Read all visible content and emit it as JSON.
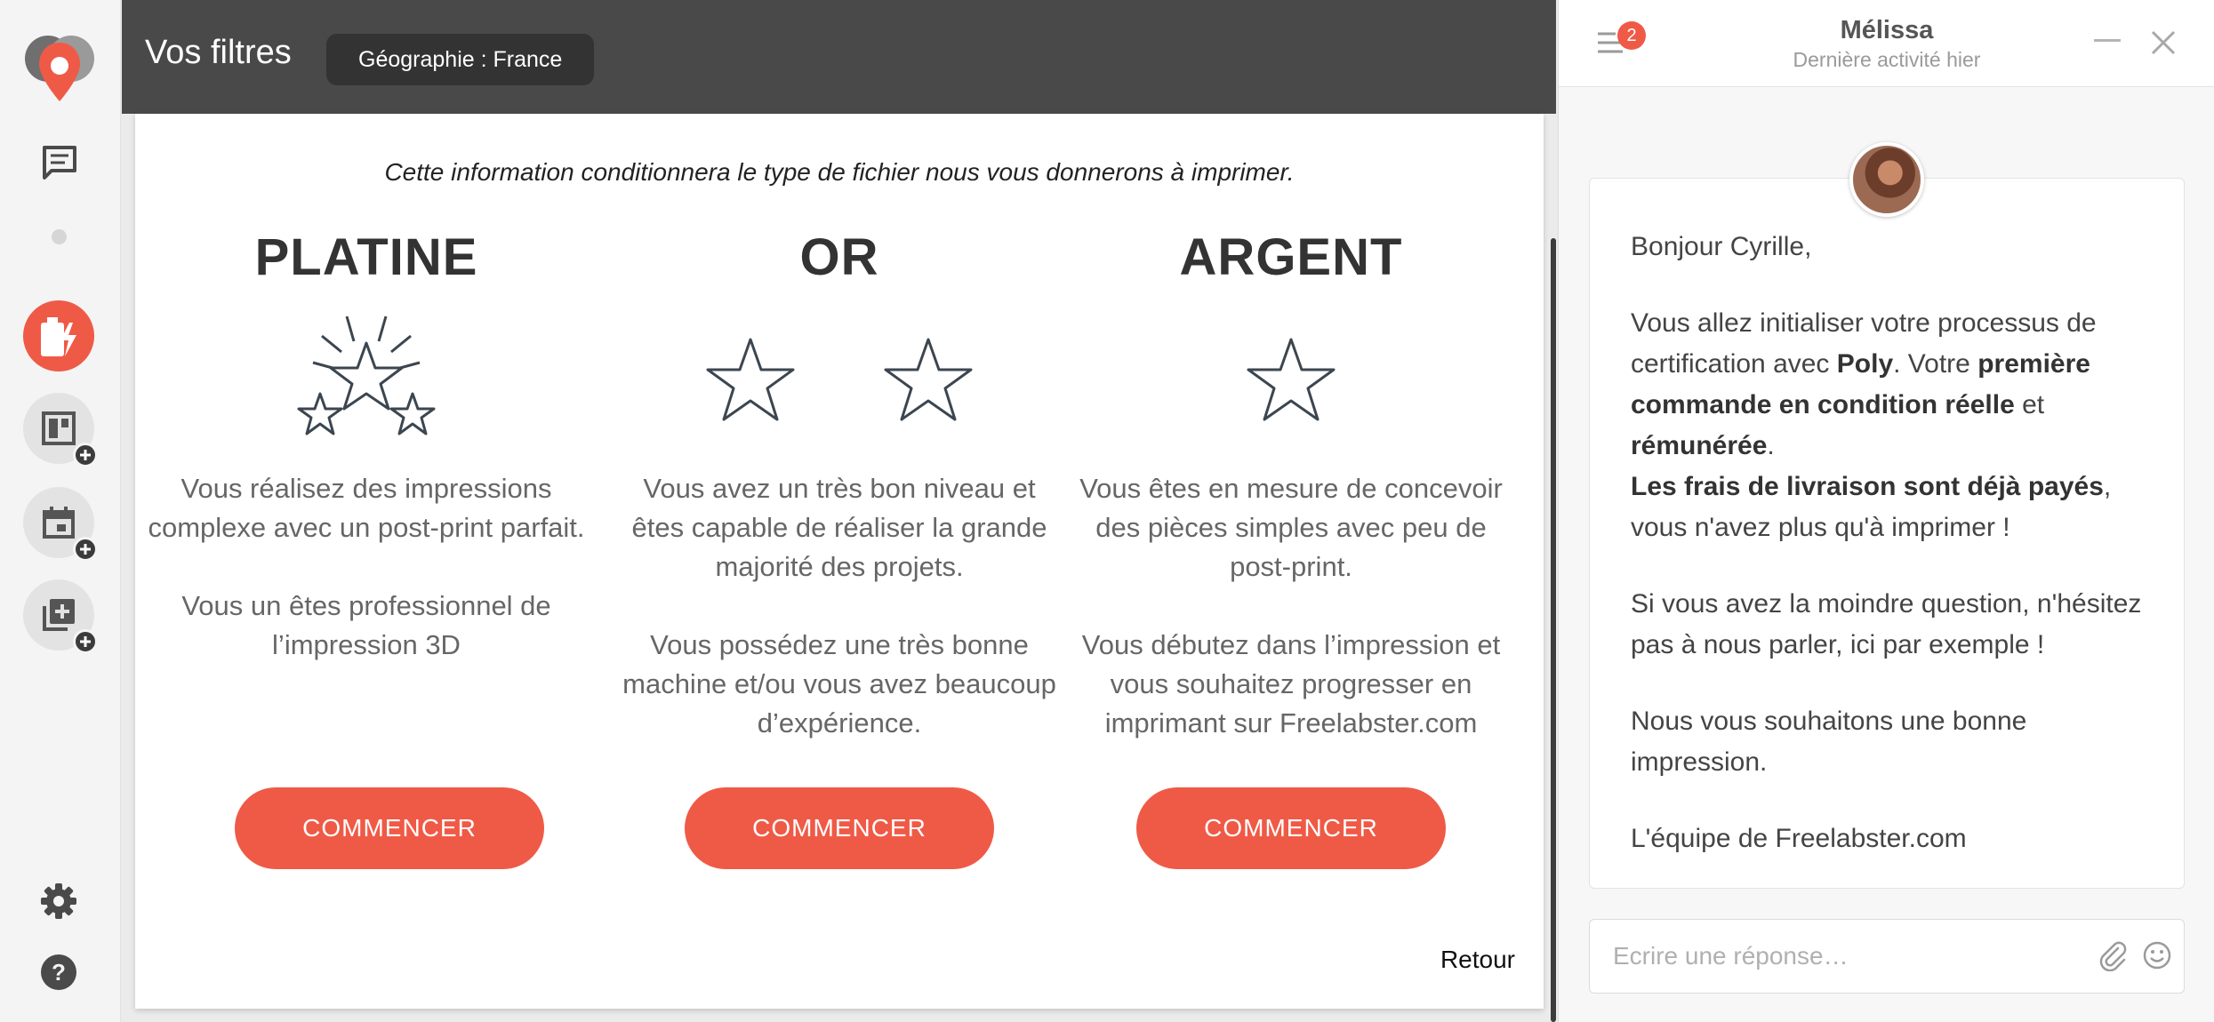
{
  "header": {
    "title": "Vos filtres",
    "geo_filter": "Géographie : France"
  },
  "sidebar": {
    "items": [
      {
        "icon": "logo-pin-icon"
      },
      {
        "icon": "chat-icon"
      },
      {
        "icon": "battery-bolt-icon"
      },
      {
        "icon": "dashboard-add-icon"
      },
      {
        "icon": "calendar-add-icon"
      },
      {
        "icon": "library-add-icon"
      },
      {
        "icon": "gear-icon"
      },
      {
        "icon": "help-icon"
      }
    ]
  },
  "main": {
    "intro": "Cette information conditionnera le type de fichier nous vous donnerons à imprimer.",
    "levels": [
      {
        "title": "PLATINE",
        "icon": "three-stars-burst-icon",
        "desc1": "Vous réalisez des impressions complexe avec un post-print parfait.",
        "desc2": "Vous un êtes professionnel de l’impression 3D",
        "button": "COMMENCER"
      },
      {
        "title": "OR",
        "icon": "two-stars-icon",
        "desc1": "Vous avez un très bon niveau et êtes capable de réaliser la grande majorité des projets.",
        "desc2": "Vous possédez une très bonne machine et/ou vous avez beaucoup d’expérience.",
        "button": "COMMENCER"
      },
      {
        "title": "ARGENT",
        "icon": "one-star-icon",
        "desc1": "Vous êtes en mesure de concevoir des pièces simples avec peu de post-print.",
        "desc2": "Vous débutez dans l’impression et vous souhaitez progresser en imprimant sur Freelabster.com",
        "button": "COMMENCER"
      }
    ],
    "back": "Retour"
  },
  "chat": {
    "badge_count": "2",
    "name": "Mélissa",
    "status": "Dernière activité hier",
    "message": {
      "greeting": "Bonjour Cyrille,",
      "p2_a": "Vous allez initialiser votre processus de certification avec ",
      "p2_poly": "Poly",
      "p2_b": ". Votre ",
      "p2_bold": "première commande en condition réelle",
      "p2_c": " et ",
      "p2_bold2": "rémunérée",
      "p2_d": ".",
      "p2_bold3": "Les frais de livraison sont déjà payés",
      "p2_e": ", vous n'avez plus qu'à imprimer !",
      "p3": "Si vous avez la moindre question, n'hésitez pas à nous parler, ici par exemple !",
      "p4": "Nous vous souhaitons une bonne impression.",
      "p5": "L'équipe de Freelabster.com"
    },
    "reply_placeholder": "Ecrire une réponse…"
  },
  "colors": {
    "accent": "#ef5a46",
    "header_bg": "#494949",
    "chip_bg": "#333333"
  }
}
